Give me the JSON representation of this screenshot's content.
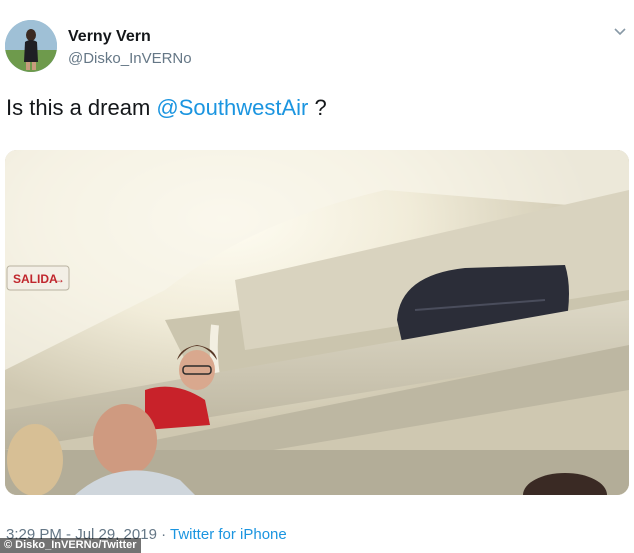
{
  "tweet": {
    "author": {
      "display_name": "Verny Vern",
      "handle": "@Disko_InVERNo"
    },
    "text_before": "Is this a dream ",
    "mention": "@SouthwestAir",
    "text_after": " ?",
    "timestamp": "3:29 PM - Jul 29, 2019",
    "separator": "·",
    "source": "Twitter for iPhone"
  },
  "photo": {
    "sign_text": "SALIDA"
  },
  "credit": "© Disko_InVERNo/Twitter",
  "icons": {
    "menu": "chevron-down-icon",
    "avatar": "user-photo"
  },
  "colors": {
    "link": "#1b95e0",
    "muted": "#657786",
    "text": "#14171a"
  }
}
